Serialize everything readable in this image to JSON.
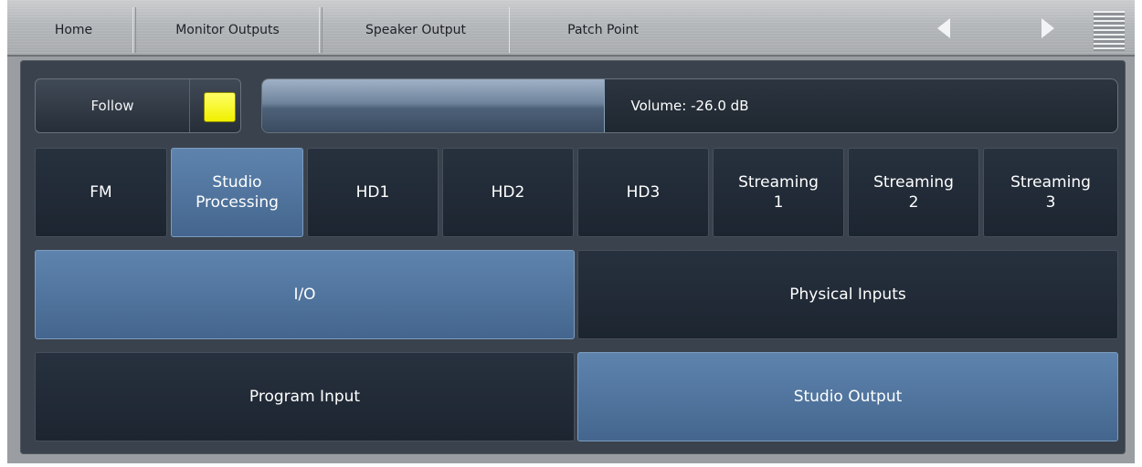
{
  "tabs": [
    {
      "label": "Home"
    },
    {
      "label": "Monitor Outputs"
    },
    {
      "label": "Speaker Output"
    },
    {
      "label": "Patch Point"
    }
  ],
  "icons": {
    "prev": "left-arrow-icon",
    "next": "right-arrow-icon",
    "menu": "hamburger-icon"
  },
  "follow": {
    "label": "Follow",
    "indicator_color": "#f0f000"
  },
  "volume": {
    "label": "Volume: -26.0 dB",
    "level_fraction": 0.4
  },
  "processing_buttons": [
    {
      "line1": "FM",
      "line2": "",
      "selected": false
    },
    {
      "line1": "Studio",
      "line2": "Processing",
      "selected": true
    },
    {
      "line1": "HD1",
      "line2": "",
      "selected": false
    },
    {
      "line1": "HD2",
      "line2": "",
      "selected": false
    },
    {
      "line1": "HD3",
      "line2": "",
      "selected": false
    },
    {
      "line1": "Streaming",
      "line2": "1",
      "selected": false
    },
    {
      "line1": "Streaming",
      "line2": "2",
      "selected": false
    },
    {
      "line1": "Streaming",
      "line2": "3",
      "selected": false
    }
  ],
  "category_buttons": [
    {
      "label": "I/O",
      "selected": true
    },
    {
      "label": "Physical Inputs",
      "selected": false
    }
  ],
  "io_buttons": [
    {
      "label": "Program Input",
      "selected": false
    },
    {
      "label": "Studio Output",
      "selected": true
    }
  ],
  "colors": {
    "selected": "#5478a2",
    "unselected": "#222b36",
    "panel": "#3a424d"
  }
}
